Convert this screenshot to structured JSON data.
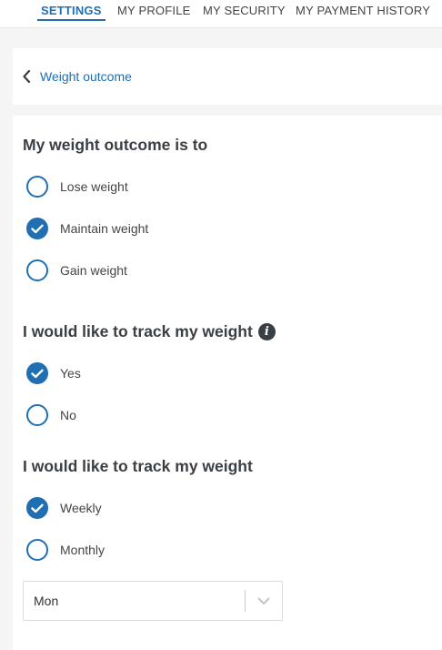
{
  "nav": {
    "tabs": [
      {
        "label": "SETTINGS",
        "active": true
      },
      {
        "label": "MY PROFILE",
        "active": false
      },
      {
        "label": "MY SECURITY",
        "active": false
      },
      {
        "label": "MY PAYMENT HISTORY",
        "active": false
      }
    ]
  },
  "header": {
    "back_label": "Weight outcome"
  },
  "outcome": {
    "title": "My weight outcome is to",
    "options": [
      {
        "label": "Lose weight",
        "checked": false
      },
      {
        "label": "Maintain weight",
        "checked": true
      },
      {
        "label": "Gain weight",
        "checked": false
      }
    ]
  },
  "tracking": {
    "title": "I would like to track my weight",
    "info_icon": "info-icon",
    "options": [
      {
        "label": "Yes",
        "checked": true
      },
      {
        "label": "No",
        "checked": false
      }
    ]
  },
  "frequency": {
    "title": "I would like to track my weight",
    "options": [
      {
        "label": "Weekly",
        "checked": true
      },
      {
        "label": "Monthly",
        "checked": false
      }
    ],
    "day_select": {
      "value": "Mon"
    }
  },
  "colors": {
    "accent": "#1f6fb2",
    "heading": "#3a3f44",
    "background": "#f5f5f5"
  }
}
